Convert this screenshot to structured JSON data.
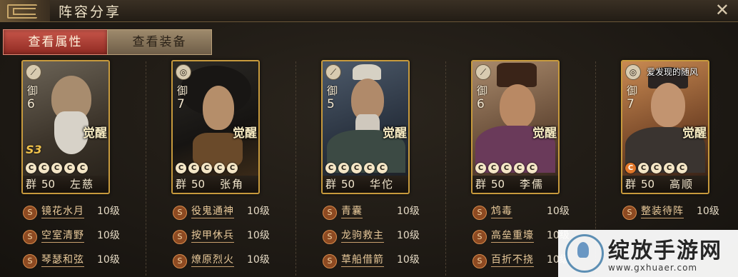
{
  "window": {
    "title": "阵容分享",
    "close_icon": "close-icon"
  },
  "tabs": [
    {
      "label": "查看属性",
      "active": true
    },
    {
      "label": "查看装备",
      "active": false
    }
  ],
  "heroes": [
    {
      "unit_type": "spear",
      "cost_label": "御",
      "cost": "6",
      "badge": "S3",
      "awaken": "觉醒",
      "stars": 5,
      "orange_stars": 0,
      "faction": "群",
      "level": "50",
      "name": "左慈",
      "tactics": [
        {
          "name": "镜花水月",
          "level": "10级"
        },
        {
          "name": "空室清野",
          "level": "10级"
        },
        {
          "name": "琴瑟和弦",
          "level": "10级"
        }
      ]
    },
    {
      "unit_type": "shield",
      "cost_label": "御",
      "cost": "7",
      "badge": "",
      "awaken": "觉醒",
      "stars": 5,
      "orange_stars": 0,
      "faction": "群",
      "level": "50",
      "name": "张角",
      "tactics": [
        {
          "name": "役鬼通神",
          "level": "10级"
        },
        {
          "name": "按甲休兵",
          "level": "10级"
        },
        {
          "name": "燎原烈火",
          "level": "10级"
        }
      ]
    },
    {
      "unit_type": "spear",
      "cost_label": "御",
      "cost": "5",
      "badge": "",
      "awaken": "觉醒",
      "stars": 5,
      "orange_stars": 0,
      "faction": "群",
      "level": "50",
      "name": "华佗",
      "tactics": [
        {
          "name": "青囊",
          "level": "10级"
        },
        {
          "name": "龙驹救主",
          "level": "10级"
        },
        {
          "name": "草船借箭",
          "level": "10级"
        }
      ]
    },
    {
      "unit_type": "spear",
      "cost_label": "御",
      "cost": "6",
      "badge": "",
      "awaken": "觉醒",
      "stars": 5,
      "orange_stars": 0,
      "faction": "群",
      "level": "50",
      "name": "李儒",
      "tactics": [
        {
          "name": "鸩毒",
          "level": "10级"
        },
        {
          "name": "高垒重壕",
          "level": "10级"
        },
        {
          "name": "百折不挠",
          "level": "10级"
        }
      ]
    },
    {
      "unit_type": "shield",
      "cost_label": "御",
      "cost": "7",
      "badge": "",
      "awaken": "觉醒",
      "stars": 5,
      "orange_stars": 1,
      "faction": "群",
      "level": "50",
      "name": "高顺",
      "tactics": [
        {
          "name": "整装待阵",
          "level": "10级"
        }
      ]
    }
  ],
  "tactic_badge": "S",
  "star_glyph": "C",
  "watermarks": {
    "top": "爱发现的随风",
    "brand": "绽放手游网",
    "url": "www.gxhuaer.com"
  },
  "colors": {
    "accent_red": "#c8564a",
    "card_border": "#c79a3d",
    "orange_star": "#e0772a"
  }
}
